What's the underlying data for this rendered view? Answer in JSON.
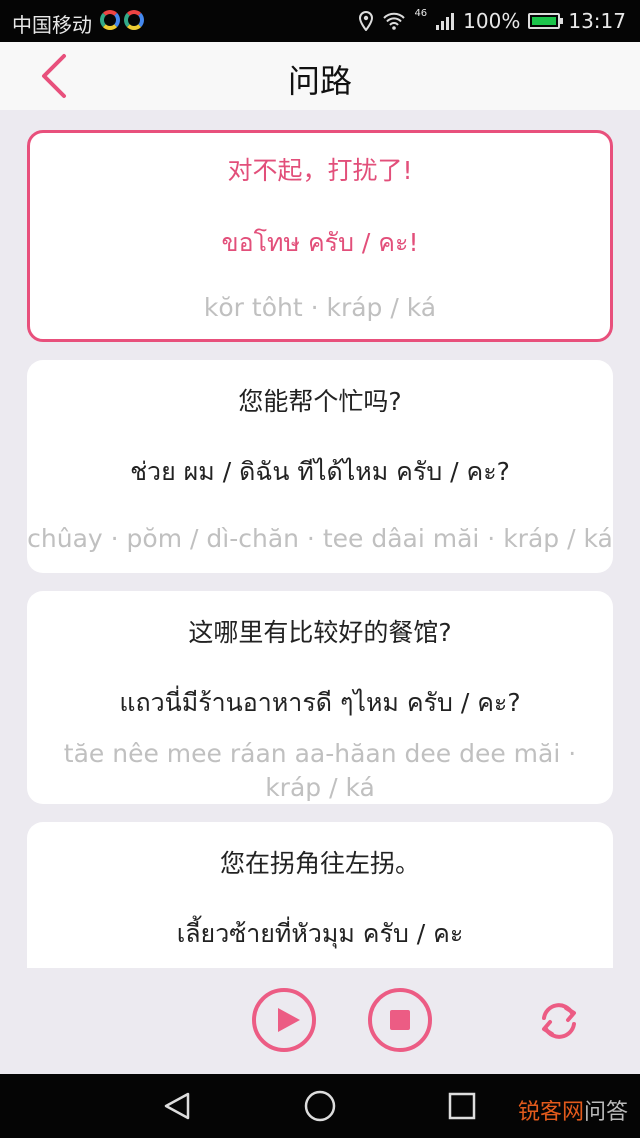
{
  "status_bar": {
    "carrier": "中国移动",
    "network": "46",
    "battery_percent": "100%",
    "time": "13:17"
  },
  "header": {
    "title": "问路",
    "back_icon": "chevron-left-icon"
  },
  "cards": [
    {
      "zh": "对不起，打扰了!",
      "th": "ขอโทษ ครับ / คะ!",
      "romanization": "kŏr tôht · kráp / ká",
      "active": true
    },
    {
      "zh": "您能帮个忙吗?",
      "th": "ช่วย ผม / ดิฉัน ทีได้ไหม ครับ / คะ?",
      "romanization": "chûay · pŏm / dì-chăn · tee dâai măi · kráp / ká",
      "active": false
    },
    {
      "zh": "这哪里有比较好的餐馆?",
      "th": "แถวนี่มีร้านอาหารดี ๆไหม ครับ / คะ?",
      "romanization": "tăe nêe mee ráan aa-hăan dee dee măi · kráp / ká",
      "active": false
    },
    {
      "zh": "您在拐角往左拐。",
      "th": "เลี้ยวซ้ายที่หัวมุม ครับ / คะ",
      "romanization": "",
      "active": false
    }
  ],
  "controls": {
    "play_icon": "play-icon",
    "stop_icon": "stop-icon",
    "loop_icon": "loop-icon"
  },
  "watermark": {
    "part1": "锐客网",
    "part2": "问答"
  },
  "colors": {
    "accent": "#e8507c",
    "card_bg": "#ffffff",
    "page_bg": "#eceaf0"
  }
}
